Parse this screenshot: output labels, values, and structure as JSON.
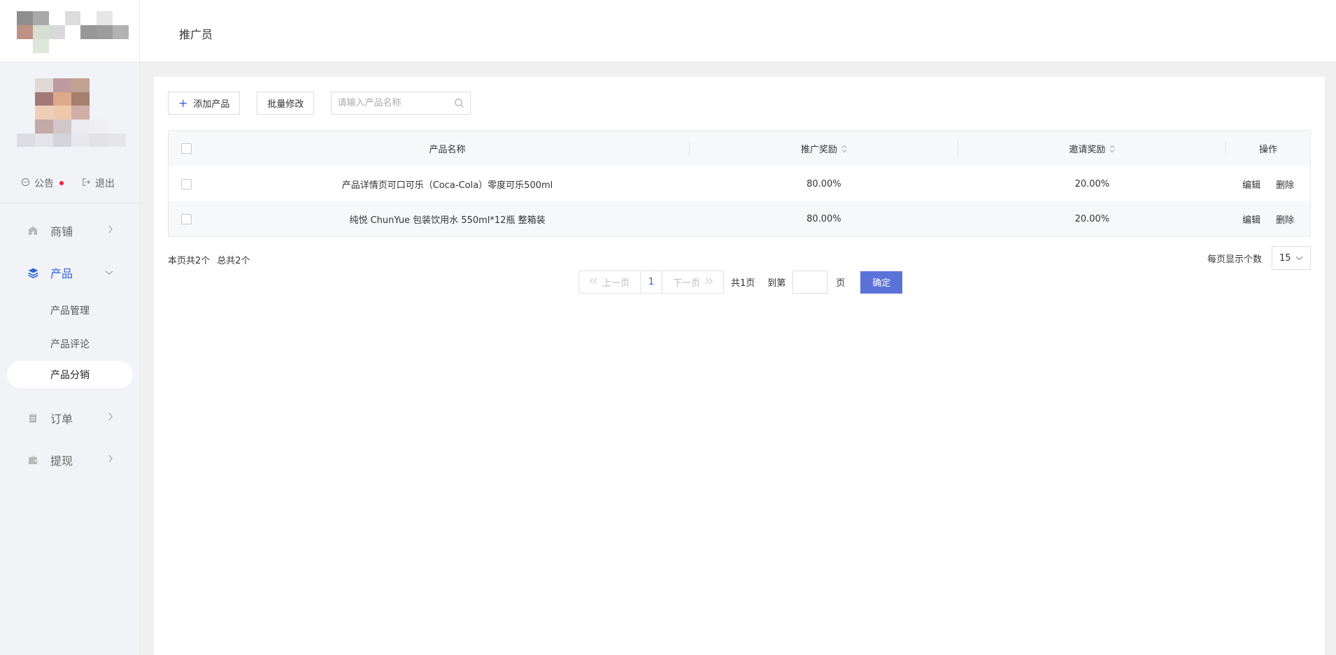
{
  "header": {
    "title": "推广员"
  },
  "sidebar": {
    "user_actions": [
      {
        "label": "公告",
        "icon": "chat-bubble-icon",
        "has_badge": true
      },
      {
        "label": "退出",
        "icon": "logout-icon"
      }
    ],
    "nav": [
      {
        "label": "商铺",
        "icon": "shop-icon",
        "expanded": false
      },
      {
        "label": "产品",
        "icon": "layers-icon",
        "expanded": true,
        "active": true,
        "children": [
          {
            "label": "产品管理"
          },
          {
            "label": "产品评论"
          },
          {
            "label": "产品分销",
            "active": true
          }
        ]
      },
      {
        "label": "订单",
        "icon": "clipboard-icon",
        "expanded": false
      },
      {
        "label": "提现",
        "icon": "wallet-icon",
        "expanded": false
      }
    ]
  },
  "toolbar": {
    "add_label": "添加产品",
    "batch_label": "批量修改",
    "search_placeholder": "请输入产品名称"
  },
  "table": {
    "columns": [
      "产品名称",
      "推广奖励",
      "邀请奖励",
      "操作"
    ],
    "rows": [
      {
        "name": "产品详情页可口可乐（Coca-Cola）零度可乐500ml",
        "promo": "80.00%",
        "invite": "20.00%",
        "edit": "编辑",
        "delete": "删除"
      },
      {
        "name": "纯悦 ChunYue 包装饮用水 550ml*12瓶 整箱装",
        "promo": "80.00%",
        "invite": "20.00%",
        "edit": "编辑",
        "delete": "删除"
      }
    ]
  },
  "footer": {
    "page_count": "本页共2个",
    "total_count": "总共2个",
    "per_page_label": "每页显示个数",
    "per_page_value": "15"
  },
  "pagination": {
    "prev": "上一页",
    "current": "1",
    "next": "下一页",
    "total_pages": "共1页",
    "goto": "到第",
    "page_unit": "页",
    "confirm": "确定"
  },
  "colors": {
    "accent": "#2f63d6",
    "confirm_button": "#5b73d8",
    "badge": "#f5222d"
  }
}
